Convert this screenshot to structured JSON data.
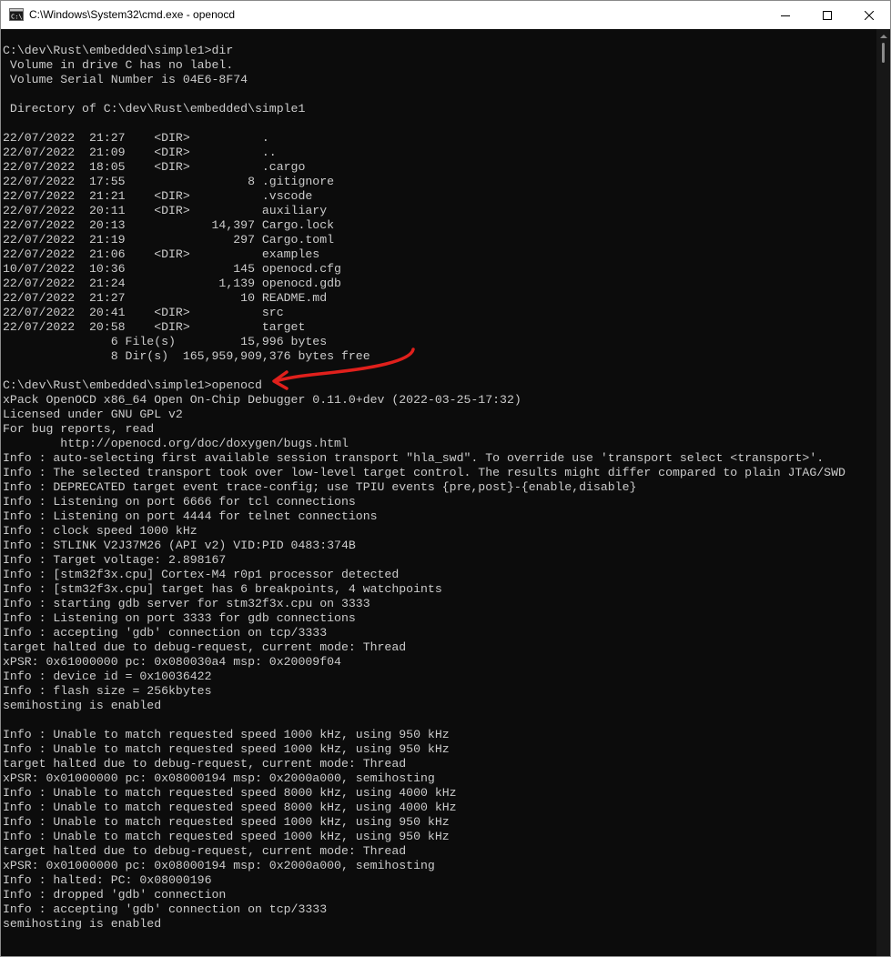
{
  "window": {
    "title": "C:\\Windows\\System32\\cmd.exe - openocd"
  },
  "console": {
    "lines": [
      "C:\\dev\\Rust\\embedded\\simple1>dir",
      " Volume in drive C has no label.",
      " Volume Serial Number is 04E6-8F74",
      "",
      " Directory of C:\\dev\\Rust\\embedded\\simple1",
      "",
      "22/07/2022  21:27    <DIR>          .",
      "22/07/2022  21:09    <DIR>          ..",
      "22/07/2022  18:05    <DIR>          .cargo",
      "22/07/2022  17:55                 8 .gitignore",
      "22/07/2022  21:21    <DIR>          .vscode",
      "22/07/2022  20:11    <DIR>          auxiliary",
      "22/07/2022  20:13            14,397 Cargo.lock",
      "22/07/2022  21:19               297 Cargo.toml",
      "22/07/2022  21:06    <DIR>          examples",
      "10/07/2022  10:36               145 openocd.cfg",
      "22/07/2022  21:24             1,139 openocd.gdb",
      "22/07/2022  21:27                10 README.md",
      "22/07/2022  20:41    <DIR>          src",
      "22/07/2022  20:58    <DIR>          target",
      "               6 File(s)         15,996 bytes",
      "               8 Dir(s)  165,959,909,376 bytes free",
      "",
      "C:\\dev\\Rust\\embedded\\simple1>openocd",
      "xPack OpenOCD x86_64 Open On-Chip Debugger 0.11.0+dev (2022-03-25-17:32)",
      "Licensed under GNU GPL v2",
      "For bug reports, read",
      "        http://openocd.org/doc/doxygen/bugs.html",
      "Info : auto-selecting first available session transport \"hla_swd\". To override use 'transport select <transport>'.",
      "Info : The selected transport took over low-level target control. The results might differ compared to plain JTAG/SWD",
      "Info : DEPRECATED target event trace-config; use TPIU events {pre,post}-{enable,disable}",
      "Info : Listening on port 6666 for tcl connections",
      "Info : Listening on port 4444 for telnet connections",
      "Info : clock speed 1000 kHz",
      "Info : STLINK V2J37M26 (API v2) VID:PID 0483:374B",
      "Info : Target voltage: 2.898167",
      "Info : [stm32f3x.cpu] Cortex-M4 r0p1 processor detected",
      "Info : [stm32f3x.cpu] target has 6 breakpoints, 4 watchpoints",
      "Info : starting gdb server for stm32f3x.cpu on 3333",
      "Info : Listening on port 3333 for gdb connections",
      "Info : accepting 'gdb' connection on tcp/3333",
      "target halted due to debug-request, current mode: Thread",
      "xPSR: 0x61000000 pc: 0x080030a4 msp: 0x20009f04",
      "Info : device id = 0x10036422",
      "Info : flash size = 256kbytes",
      "semihosting is enabled",
      "",
      "Info : Unable to match requested speed 1000 kHz, using 950 kHz",
      "Info : Unable to match requested speed 1000 kHz, using 950 kHz",
      "target halted due to debug-request, current mode: Thread",
      "xPSR: 0x01000000 pc: 0x08000194 msp: 0x2000a000, semihosting",
      "Info : Unable to match requested speed 8000 kHz, using 4000 kHz",
      "Info : Unable to match requested speed 8000 kHz, using 4000 kHz",
      "Info : Unable to match requested speed 1000 kHz, using 950 kHz",
      "Info : Unable to match requested speed 1000 kHz, using 950 kHz",
      "target halted due to debug-request, current mode: Thread",
      "xPSR: 0x01000000 pc: 0x08000194 msp: 0x2000a000, semihosting",
      "Info : halted: PC: 0x08000196",
      "Info : dropped 'gdb' connection",
      "Info : accepting 'gdb' connection on tcp/3333",
      "semihosting is enabled"
    ]
  },
  "icons": {
    "app": "cmd-icon",
    "minimize": "minimize-icon",
    "maximize": "maximize-icon",
    "close": "close-icon"
  },
  "colors": {
    "background": "#0c0c0c",
    "text": "#cccccc",
    "titlebar": "#ffffff",
    "annotation": "#e0201c"
  }
}
